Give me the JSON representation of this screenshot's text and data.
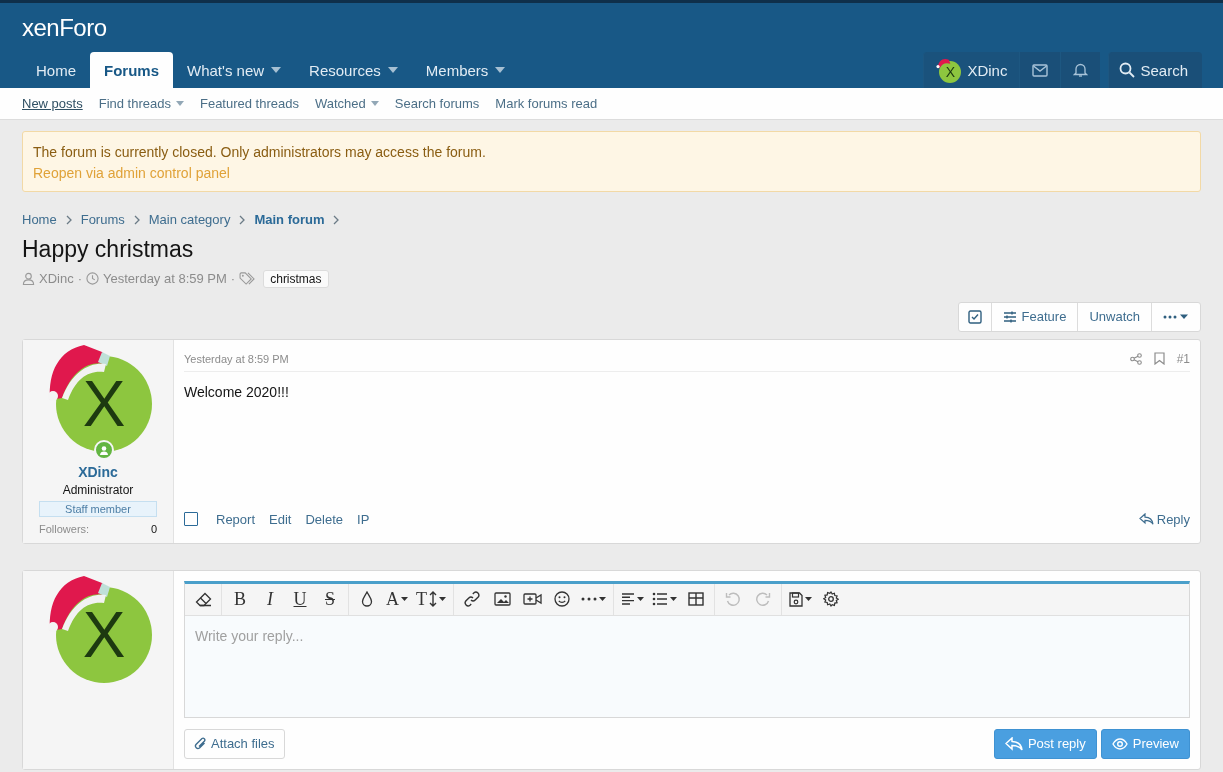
{
  "header": {
    "logo": "xenForo",
    "nav": [
      {
        "label": "Home",
        "selected": false,
        "dropdown": false
      },
      {
        "label": "Forums",
        "selected": true,
        "dropdown": false
      },
      {
        "label": "What's new",
        "selected": false,
        "dropdown": true
      },
      {
        "label": "Resources",
        "selected": false,
        "dropdown": true
      },
      {
        "label": "Members",
        "selected": false,
        "dropdown": true
      }
    ],
    "user": {
      "name": "XDinc",
      "avatar_letter": "X"
    },
    "search": "Search"
  },
  "subnav": [
    {
      "label": "New posts",
      "underlined": true,
      "dropdown": false
    },
    {
      "label": "Find threads",
      "underlined": false,
      "dropdown": true
    },
    {
      "label": "Featured threads",
      "underlined": false,
      "dropdown": false
    },
    {
      "label": "Watched",
      "underlined": false,
      "dropdown": true
    },
    {
      "label": "Search forums",
      "underlined": false,
      "dropdown": false
    },
    {
      "label": "Mark forums read",
      "underlined": false,
      "dropdown": false
    }
  ],
  "notice": {
    "text": "The forum is currently closed. Only administrators may access the forum.",
    "link": "Reopen via admin control panel"
  },
  "breadcrumbs": [
    {
      "label": "Home",
      "current": false
    },
    {
      "label": "Forums",
      "current": false
    },
    {
      "label": "Main category",
      "current": false
    },
    {
      "label": "Main forum",
      "current": true
    }
  ],
  "thread": {
    "title": "Happy christmas",
    "author": "XDinc",
    "date": "Yesterday at 8:59 PM",
    "separators": [
      "·",
      "·"
    ],
    "tags": [
      "christmas"
    ]
  },
  "thread_actions": [
    {
      "kind": "select"
    },
    {
      "kind": "feature",
      "label": "Feature"
    },
    {
      "kind": "plain",
      "label": "Unwatch"
    },
    {
      "kind": "more"
    }
  ],
  "post": {
    "avatar_letter": "X",
    "online": true,
    "user": "XDinc",
    "user_title": "Administrator",
    "banner": "Staff member",
    "stats": [
      {
        "label": "Followers:",
        "value": "0"
      }
    ],
    "date": "Yesterday at 8:59 PM",
    "number": "#1",
    "body": "Welcome 2020!!!",
    "selected": false,
    "actions": [
      "Report",
      "Edit",
      "Delete",
      "IP"
    ],
    "reply": "Reply"
  },
  "reply": {
    "avatar_letter": "X",
    "toolbar": [
      [
        {
          "kind": "eraser",
          "dropdown": false,
          "disabled": false
        }
      ],
      [
        {
          "kind": "bold",
          "glyph": "B",
          "dropdown": false,
          "disabled": false
        },
        {
          "kind": "italic",
          "glyph": "I",
          "dropdown": false,
          "disabled": false
        },
        {
          "kind": "underline",
          "glyph": "U",
          "dropdown": false,
          "disabled": false
        },
        {
          "kind": "strike",
          "glyph": "S",
          "dropdown": false,
          "disabled": false
        }
      ],
      [
        {
          "kind": "drop",
          "dropdown": false,
          "disabled": false
        },
        {
          "kind": "font",
          "glyph": "A",
          "dropdown": true,
          "disabled": false
        },
        {
          "kind": "size",
          "glyph": "T",
          "dropdown": true,
          "disabled": false
        }
      ],
      [
        {
          "kind": "link",
          "dropdown": false,
          "disabled": false
        },
        {
          "kind": "image",
          "dropdown": false,
          "disabled": false
        },
        {
          "kind": "video",
          "dropdown": false,
          "disabled": false
        },
        {
          "kind": "smile",
          "dropdown": false,
          "disabled": false
        },
        {
          "kind": "more",
          "dropdown": true,
          "disabled": false
        }
      ],
      [
        {
          "kind": "align",
          "dropdown": true,
          "disabled": false
        },
        {
          "kind": "list",
          "dropdown": true,
          "disabled": false
        },
        {
          "kind": "table",
          "dropdown": false,
          "disabled": false
        }
      ],
      [
        {
          "kind": "undo",
          "dropdown": false,
          "disabled": true
        },
        {
          "kind": "redo",
          "dropdown": false,
          "disabled": true
        }
      ],
      [
        {
          "kind": "save",
          "dropdown": true,
          "disabled": false
        },
        {
          "kind": "gear",
          "dropdown": false,
          "disabled": false
        }
      ]
    ],
    "placeholder": "Write your reply...",
    "attach": "Attach files",
    "post": "Post reply",
    "preview": "Preview"
  }
}
